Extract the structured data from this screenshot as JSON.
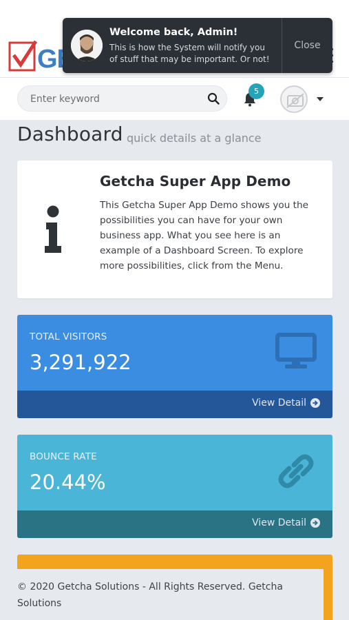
{
  "brand": {
    "logo_text": "GETCHA"
  },
  "toast": {
    "title": "Welcome back, Admin!",
    "message": "This is how the System will notify you of stuff that may be important. Or not!",
    "close_label": "Close"
  },
  "header": {
    "search_placeholder": "Enter keyword",
    "notification_count": "5"
  },
  "page": {
    "title": "Dashboard",
    "subtitle": "quick details at a glance"
  },
  "info_card": {
    "title": "Getcha Super App Demo",
    "body": "This Getcha Super App Demo shows you the possibilities you can have for your own business app. What you see here is an example of a Dashboard Screen. To explore more possibilities, click from the Menu."
  },
  "stats": [
    {
      "label": "TOTAL VISITORS",
      "value": "3,291,922",
      "link": "View Detail",
      "color": "#3a8de0",
      "icon": "monitor-icon"
    },
    {
      "label": "BOUNCE RATE",
      "value": "20.44%",
      "link": "View Detail",
      "color": "#4bb5d8",
      "icon": "link-icon"
    }
  ],
  "orange_card_color": "#f3a31e",
  "footer": {
    "text": "© 2020 Getcha Solutions - All Rights Reserved. Getcha Solutions"
  }
}
